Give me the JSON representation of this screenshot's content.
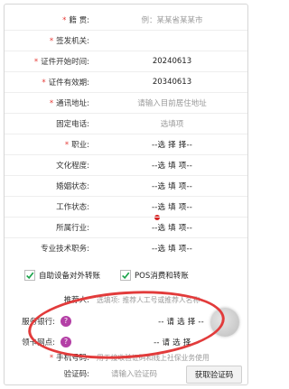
{
  "form": {
    "rows": [
      {
        "label": "籍  贯:",
        "value": "例：某某省某某市",
        "placeholder": true,
        "required": true
      },
      {
        "label": "签发机关:",
        "value": "",
        "placeholder": true,
        "required": true
      },
      {
        "label": "证件开始时间:",
        "value": "20240613",
        "placeholder": false,
        "required": true
      },
      {
        "label": "证件有效期:",
        "value": "20340613",
        "placeholder": false,
        "required": true
      },
      {
        "label": "通讯地址:",
        "value": "请输入目前居住地址",
        "placeholder": true,
        "required": true
      },
      {
        "label": "固定电话:",
        "value": "选填项",
        "placeholder": true,
        "required": false
      },
      {
        "label": "职业:",
        "value": "--选 择 择--",
        "placeholder": false,
        "required": true
      },
      {
        "label": "文化程度:",
        "value": "--选 填 项--",
        "placeholder": false,
        "required": false
      },
      {
        "label": "婚姻状态:",
        "value": "--选 填 项--",
        "placeholder": false,
        "required": false
      },
      {
        "label": "工作状态:",
        "value": "--选 填 项--",
        "placeholder": false,
        "required": false
      },
      {
        "label": "所属行业:",
        "value": "--选 填 项--",
        "placeholder": false,
        "required": false
      },
      {
        "label": "专业技术职务:",
        "value": "--选 填 项--",
        "placeholder": false,
        "required": false
      }
    ]
  },
  "checks": {
    "self_service": "自助设备对外转账",
    "pos": "POS消费和转账"
  },
  "lower": {
    "referrer_label": "推荐人:",
    "referrer_placeholder": "选填项: 推荐人工号或推荐人名称",
    "service_bank_label": "服务银行:",
    "service_bank_value": "-- 请 选 择 --",
    "card_branch_label": "领卡网点:",
    "card_branch_value": "-- 请 选 择 --",
    "q_mark": "?",
    "phone_label": "手机号码:",
    "phone_placeholder": "用于接收验证码和线上社保业务使用",
    "code_label": "验证码:",
    "code_placeholder": "请输入验证码",
    "get_code": "获取验证码"
  },
  "colors": {
    "required": "#e53935",
    "annotation": "#e23b3b",
    "badge": "#b43fa6"
  }
}
